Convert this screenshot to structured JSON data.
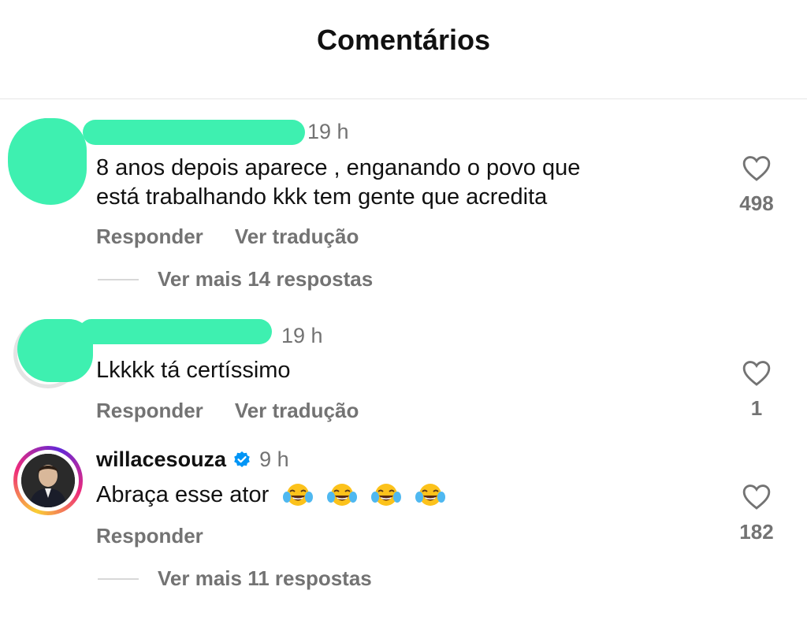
{
  "header": {
    "title": "Comentários"
  },
  "comments": [
    {
      "username": "",
      "time": "19 h",
      "text_line1": "8 anos depois aparece , enganando o povo que",
      "text_line2": "está trabalhando kkk tem gente que acredita",
      "reply_label": "Responder",
      "translate_label": "Ver tradução",
      "likes": "498",
      "more_replies": "Ver mais 14 respostas"
    },
    {
      "username": "",
      "time": "19 h",
      "text": "Lkkkk tá certíssimo",
      "reply_label": "Responder",
      "translate_label": "Ver tradução",
      "likes": "1"
    },
    {
      "username": "willacesouza",
      "verified": true,
      "time": "9 h",
      "text": "Abraça esse ator",
      "emojis": [
        "😂",
        "😂",
        "😂",
        "😂"
      ],
      "reply_label": "Responder",
      "likes": "182",
      "more_replies": "Ver mais 11 respostas"
    }
  ],
  "colors": {
    "redaction": "#3ef0b0",
    "verified": "#0095f6",
    "muted": "#737373"
  }
}
